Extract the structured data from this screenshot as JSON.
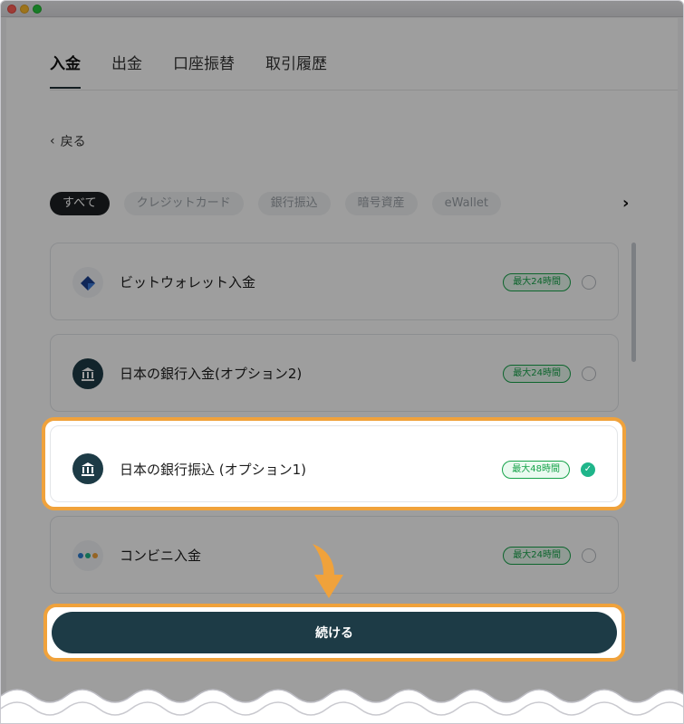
{
  "tabs": [
    {
      "label": "入金",
      "active": true
    },
    {
      "label": "出金",
      "active": false
    },
    {
      "label": "口座振替",
      "active": false
    },
    {
      "label": "取引履歴",
      "active": false
    }
  ],
  "back": {
    "label": "戻る"
  },
  "filters": {
    "chips": [
      {
        "label": "すべて",
        "active": true
      },
      {
        "label": "クレジットカード",
        "active": false
      },
      {
        "label": "銀行振込",
        "active": false
      },
      {
        "label": "暗号資産",
        "active": false
      },
      {
        "label": "eWallet",
        "active": false
      }
    ]
  },
  "methods": [
    {
      "name": "ビットウォレット入金",
      "badge": "最大24時間",
      "icon": "bitwallet-icon",
      "selected": false
    },
    {
      "name": "日本の銀行入金(オプション2)",
      "badge": "最大24時間",
      "icon": "bank-icon",
      "selected": false
    },
    {
      "name": "日本の銀行振込 (オプション1)",
      "badge": "最大48時間",
      "icon": "bank-icon",
      "selected": true
    },
    {
      "name": "コンビニ入金",
      "badge": "最大24時間",
      "icon": "convenience-store-icon",
      "selected": false
    }
  ],
  "continue_label": "続ける",
  "colors": {
    "primary": "#1d3b46",
    "highlight": "#f0a23b",
    "success": "#1fb58a",
    "badge_green": "#16a34a"
  }
}
